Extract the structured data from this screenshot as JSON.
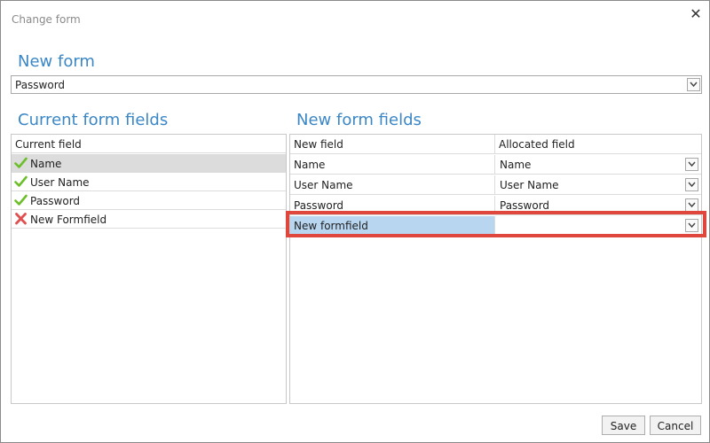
{
  "window": {
    "title": "Change form"
  },
  "new_form": {
    "heading": "New form",
    "selected": "Password"
  },
  "current_fields": {
    "heading": "Current form fields",
    "column": "Current field",
    "items": [
      {
        "label": "Name",
        "status": "check",
        "selected": true
      },
      {
        "label": "User Name",
        "status": "check",
        "selected": false
      },
      {
        "label": "Password",
        "status": "check",
        "selected": false
      },
      {
        "label": "New Formfield",
        "status": "cross",
        "selected": false
      }
    ]
  },
  "new_fields": {
    "heading": "New form fields",
    "columns": [
      "New field",
      "Allocated field"
    ],
    "rows": [
      {
        "field": "Name",
        "allocated": "Name"
      },
      {
        "field": "User Name",
        "allocated": "User Name"
      },
      {
        "field": "Password",
        "allocated": "Password"
      },
      {
        "field": "New formfield",
        "allocated": ""
      }
    ]
  },
  "buttons": {
    "save": "Save",
    "cancel": "Cancel"
  },
  "colors": {
    "accent": "#3b87c6",
    "check": "#6cbf2a",
    "cross": "#e05050",
    "highlight": "#e0473c",
    "row_selected": "#dcdcdc",
    "cell_selected": "#b8d6f0"
  },
  "icons": {
    "close": "close-icon",
    "check": "check-icon",
    "cross": "cross-icon",
    "dropdown": "chevron-down-icon"
  }
}
